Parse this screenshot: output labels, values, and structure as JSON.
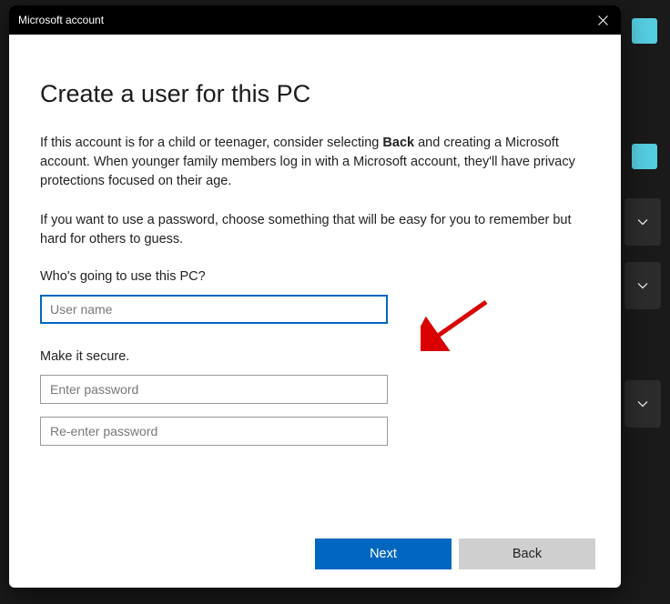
{
  "window": {
    "title": "Microsoft account"
  },
  "page": {
    "heading": "Create a user for this PC",
    "para1_a": "If this account is for a child or teenager, consider selecting ",
    "para1_bold": "Back",
    "para1_b": " and creating a Microsoft account. When younger family members log in with a Microsoft account, they'll have privacy protections focused on their age.",
    "para2": "If you want to use a password, choose something that will be easy for you to remember but hard for others to guess."
  },
  "form": {
    "who_label": "Who's going to use this PC?",
    "username_placeholder": "User name",
    "secure_label": "Make it secure.",
    "password_placeholder": "Enter password",
    "password2_placeholder": "Re-enter password"
  },
  "buttons": {
    "next": "Next",
    "back": "Back"
  }
}
